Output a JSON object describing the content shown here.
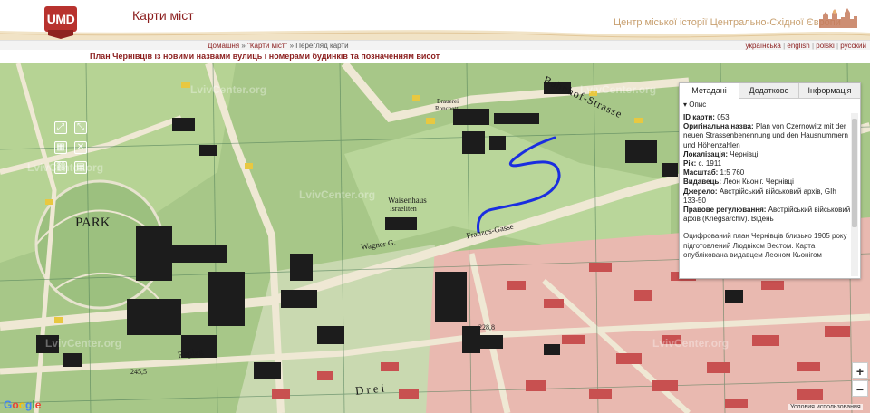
{
  "header": {
    "logo_text": "UMD",
    "site_title": "Карти міст",
    "center_title": "Центр міської історії Центрально-Східної Європи"
  },
  "breadcrumb": {
    "home": "Домашня",
    "section": "\"Карти міст\"",
    "current": "Перегляд карти",
    "separator": "»"
  },
  "languages": [
    "українська",
    "english",
    "polski",
    "русский"
  ],
  "page_title": "План Чернівців із новими назвами вулиць і номерами будинків та позначенням висот",
  "map": {
    "labels": {
      "park": "PARK",
      "street_wagner": "Wagner G.",
      "street_franzos": "Franzos-Gasse",
      "street_bahnhof": "Bahnhof-Strasse",
      "street_drei": "Drei",
      "street_replag": "Replag",
      "waisenhaus": "Waisenhaus",
      "israeliten": "Israeliten",
      "brauerei": "Brauerei",
      "ronchetti": "Ronchetti",
      "elev_245": "245,5",
      "elev_228": "228,8"
    },
    "watermark": "LvivCenter.org",
    "route_color": "#1a2ee0",
    "google_text": [
      "G",
      "o",
      "o",
      "g",
      "l",
      "e"
    ],
    "terms": "Условия использования",
    "zoom_in": "+",
    "zoom_out": "−",
    "tools": [
      "⤢",
      "⤡",
      "▦",
      "✕",
      "⛓",
      "▤"
    ]
  },
  "panel": {
    "tabs": [
      "Метадані",
      "Додатково",
      "Інформація"
    ],
    "active_tab": "Метадані",
    "section_label": "Опис",
    "fields": [
      {
        "label": "ID карти:",
        "value": "053"
      },
      {
        "label": "Оригінальна назва:",
        "value": "Plan von Czernowitz mit der neuen Strassenbenennung und den Hausnummern und Höhenzahlen"
      },
      {
        "label": "Локалізація:",
        "value": "Чернівці"
      },
      {
        "label": "Рік:",
        "value": "с. 1911"
      },
      {
        "label": "Масштаб:",
        "value": "1:5 760"
      },
      {
        "label": "Видавець:",
        "value": "Леон Кьоніг. Чернівці"
      },
      {
        "label": "Джерело:",
        "value": "Австрійський військовий архів, GIh 133-50"
      },
      {
        "label": "Правове регулювання:",
        "value": "Австрійський військовий архів (Kriegsarchiv). Відень"
      }
    ],
    "description": "Оцифрований план Чернівців близько 1905 року підготовлений Людвіком Вестом. Карта опублікована видавцем Леоном Кьонігом"
  }
}
